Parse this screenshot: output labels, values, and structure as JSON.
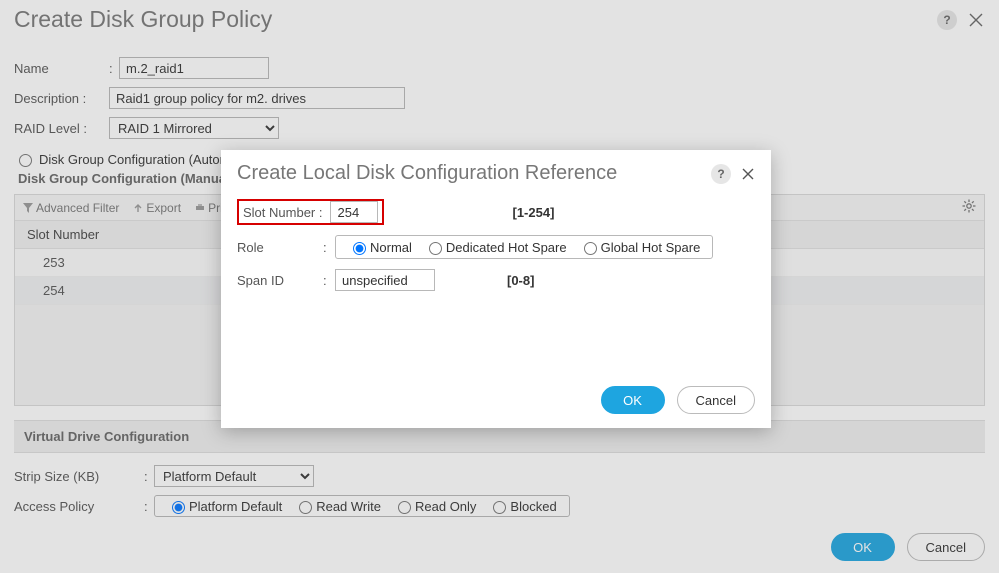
{
  "outer": {
    "title": "Create Disk Group Policy",
    "fields": {
      "name_label": "Name",
      "name_value": "m.2_raid1",
      "desc_label": "Description :",
      "desc_value": "Raid1 group policy for m2. drives",
      "raid_label": "RAID Level :",
      "raid_value": "RAID 1 Mirrored"
    },
    "cfg_auto": "Disk Group Configuration (Automatic)",
    "cfg_manual": "Disk Group Configuration (Manual)",
    "toolbar": {
      "filter": "Advanced Filter",
      "export": "Export",
      "print": "Print"
    },
    "table": {
      "col1": "Slot Number",
      "rows": [
        "253",
        "254"
      ]
    },
    "vdc_title": "Virtual Drive Configuration",
    "strip_label": "Strip Size (KB)",
    "strip_value": "Platform Default",
    "access_label": "Access Policy",
    "access_options": [
      "Platform Default",
      "Read Write",
      "Read Only",
      "Blocked"
    ],
    "ok": "OK",
    "cancel": "Cancel"
  },
  "modal": {
    "title": "Create Local Disk Configuration Reference",
    "slot_label": "Slot Number :",
    "slot_value": "254",
    "slot_range": "[1-254]",
    "role_label": "Role",
    "role_options": [
      "Normal",
      "Dedicated Hot Spare",
      "Global Hot Spare"
    ],
    "span_label": "Span ID",
    "span_value": "unspecified",
    "span_range": "[0-8]",
    "ok": "OK",
    "cancel": "Cancel"
  }
}
